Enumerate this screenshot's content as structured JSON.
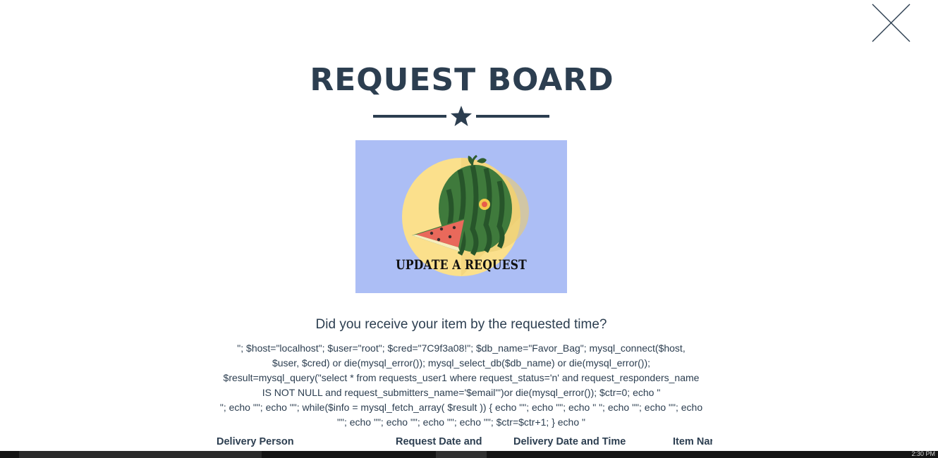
{
  "close": {
    "icon": "close-icon"
  },
  "header": {
    "title": "REQUEST BOARD",
    "divider_icon": "star-icon"
  },
  "promo": {
    "caption": "UPDATE A REQUEST",
    "image": "watermelon-illustration"
  },
  "question": "Did you receive your item by the requested time?",
  "code_text": "\"; $host=\"localhost\"; $user=\"root\"; $cred=\"7C9f3a08!\"; $db_name=\"Favor_Bag\"; mysql_connect($host,\n$user, $cred) or die(mysql_error()); mysql_select_db($db_name) or die(mysql_error());\n$result=mysql_query(\"select * from requests_user1 where request_status='n' and request_responders_name\nIS NOT NULL and request_submitters_name='$email'\")or die(mysql_error()); $ctr=0; echo \"\n\"; echo \"\"; echo \"\"; while($info = mysql_fetch_array( $result )) { echo \"\"; echo \"\"; echo \" \"; echo \"\"; echo \"\"; echo\n\"\"; echo \"\"; echo \"\"; echo \"\"; echo \"\"; $ctr=$ctr+1; } echo \"",
  "table": {
    "columns": [
      "Delivery Person",
      "Request Date and",
      "Delivery Date and Time",
      "Item Nar"
    ]
  },
  "taskbar": {
    "clock": "2:30 PM"
  }
}
